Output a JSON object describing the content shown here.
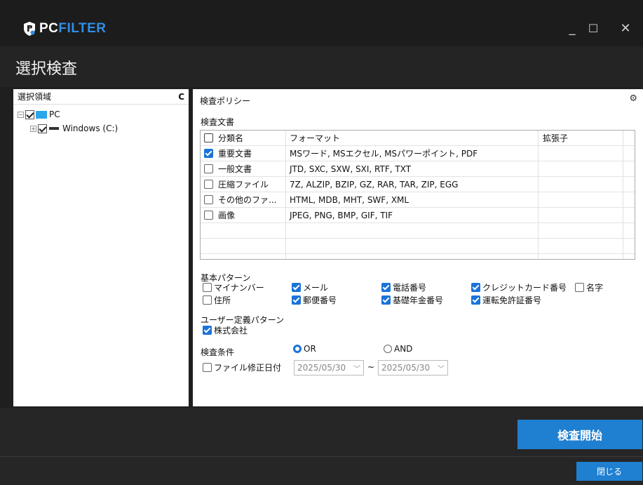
{
  "app": {
    "logo_pc": "PC",
    "logo_filter": "FILTER",
    "minimize_icon": "minimize-icon",
    "maximize_icon": "maximize-icon",
    "close_icon": "close-icon",
    "minimize_glyph": "_",
    "maximize_glyph": "☐",
    "close_glyph": "✕"
  },
  "page": {
    "title": "選択検査"
  },
  "left_panel": {
    "header": "選択領域",
    "refresh_icon": "refresh-icon",
    "refresh_glyph": "C",
    "tree": {
      "root_label": "PC",
      "child_label": "Windows (C:)",
      "root_checked": true,
      "child_checked": true
    }
  },
  "right_panel": {
    "header": "検査ポリシー",
    "settings_icon": "gear-icon",
    "settings_glyph": "⚙",
    "doc_section_label": "検査文書",
    "columns": [
      "分類名",
      "フォーマット",
      "拡張子"
    ],
    "rows": [
      {
        "category": "重要文書",
        "formats": "MSワード, MSエクセル, MSパワーポイント, PDF",
        "ext": "",
        "checked": true
      },
      {
        "category": "一般文書",
        "formats": "JTD, SXC, SXW, SXI, RTF, TXT",
        "ext": "",
        "checked": false
      },
      {
        "category": "圧縮ファイル",
        "formats": "7Z, ALZIP, BZIP, GZ, RAR, TAR, ZIP, EGG",
        "ext": "",
        "checked": false
      },
      {
        "category": "その他のファ...",
        "formats": "HTML, MDB, MHT, SWF, XML",
        "ext": "",
        "checked": false
      },
      {
        "category": "画像",
        "formats": "JPEG, PNG, BMP, GIF, TIF",
        "ext": "",
        "checked": false
      }
    ],
    "basic_pattern_label": "基本パターン",
    "basic_patterns": [
      {
        "label": "マイナンバー",
        "checked": false
      },
      {
        "label": "メール",
        "checked": true
      },
      {
        "label": "電話番号",
        "checked": true
      },
      {
        "label": "クレジットカード番号",
        "checked": true
      },
      {
        "label": "名字",
        "checked": false
      },
      {
        "label": "住所",
        "checked": false
      },
      {
        "label": "郵便番号",
        "checked": true
      },
      {
        "label": "基礎年金番号",
        "checked": true
      },
      {
        "label": "運転免許証番号",
        "checked": true
      }
    ],
    "user_pattern_label": "ユーザー定義パターン",
    "user_patterns": [
      {
        "label": "株式会社",
        "checked": true
      }
    ],
    "condition_label": "検査条件",
    "condition_or": "OR",
    "condition_and": "AND",
    "condition_selected": "OR",
    "file_date_label": "ファイル修正日付",
    "file_date_checked": false,
    "date_from": "2025/05/30",
    "date_to": "2025/05/30",
    "date_separator": "~"
  },
  "footer": {
    "start_button": "検査開始",
    "close_button": "閉じる"
  },
  "colors": {
    "accent": "#1f7fd0",
    "logo_filter": "#2f8ee6",
    "checkbox_blue": "#1a73d9"
  }
}
